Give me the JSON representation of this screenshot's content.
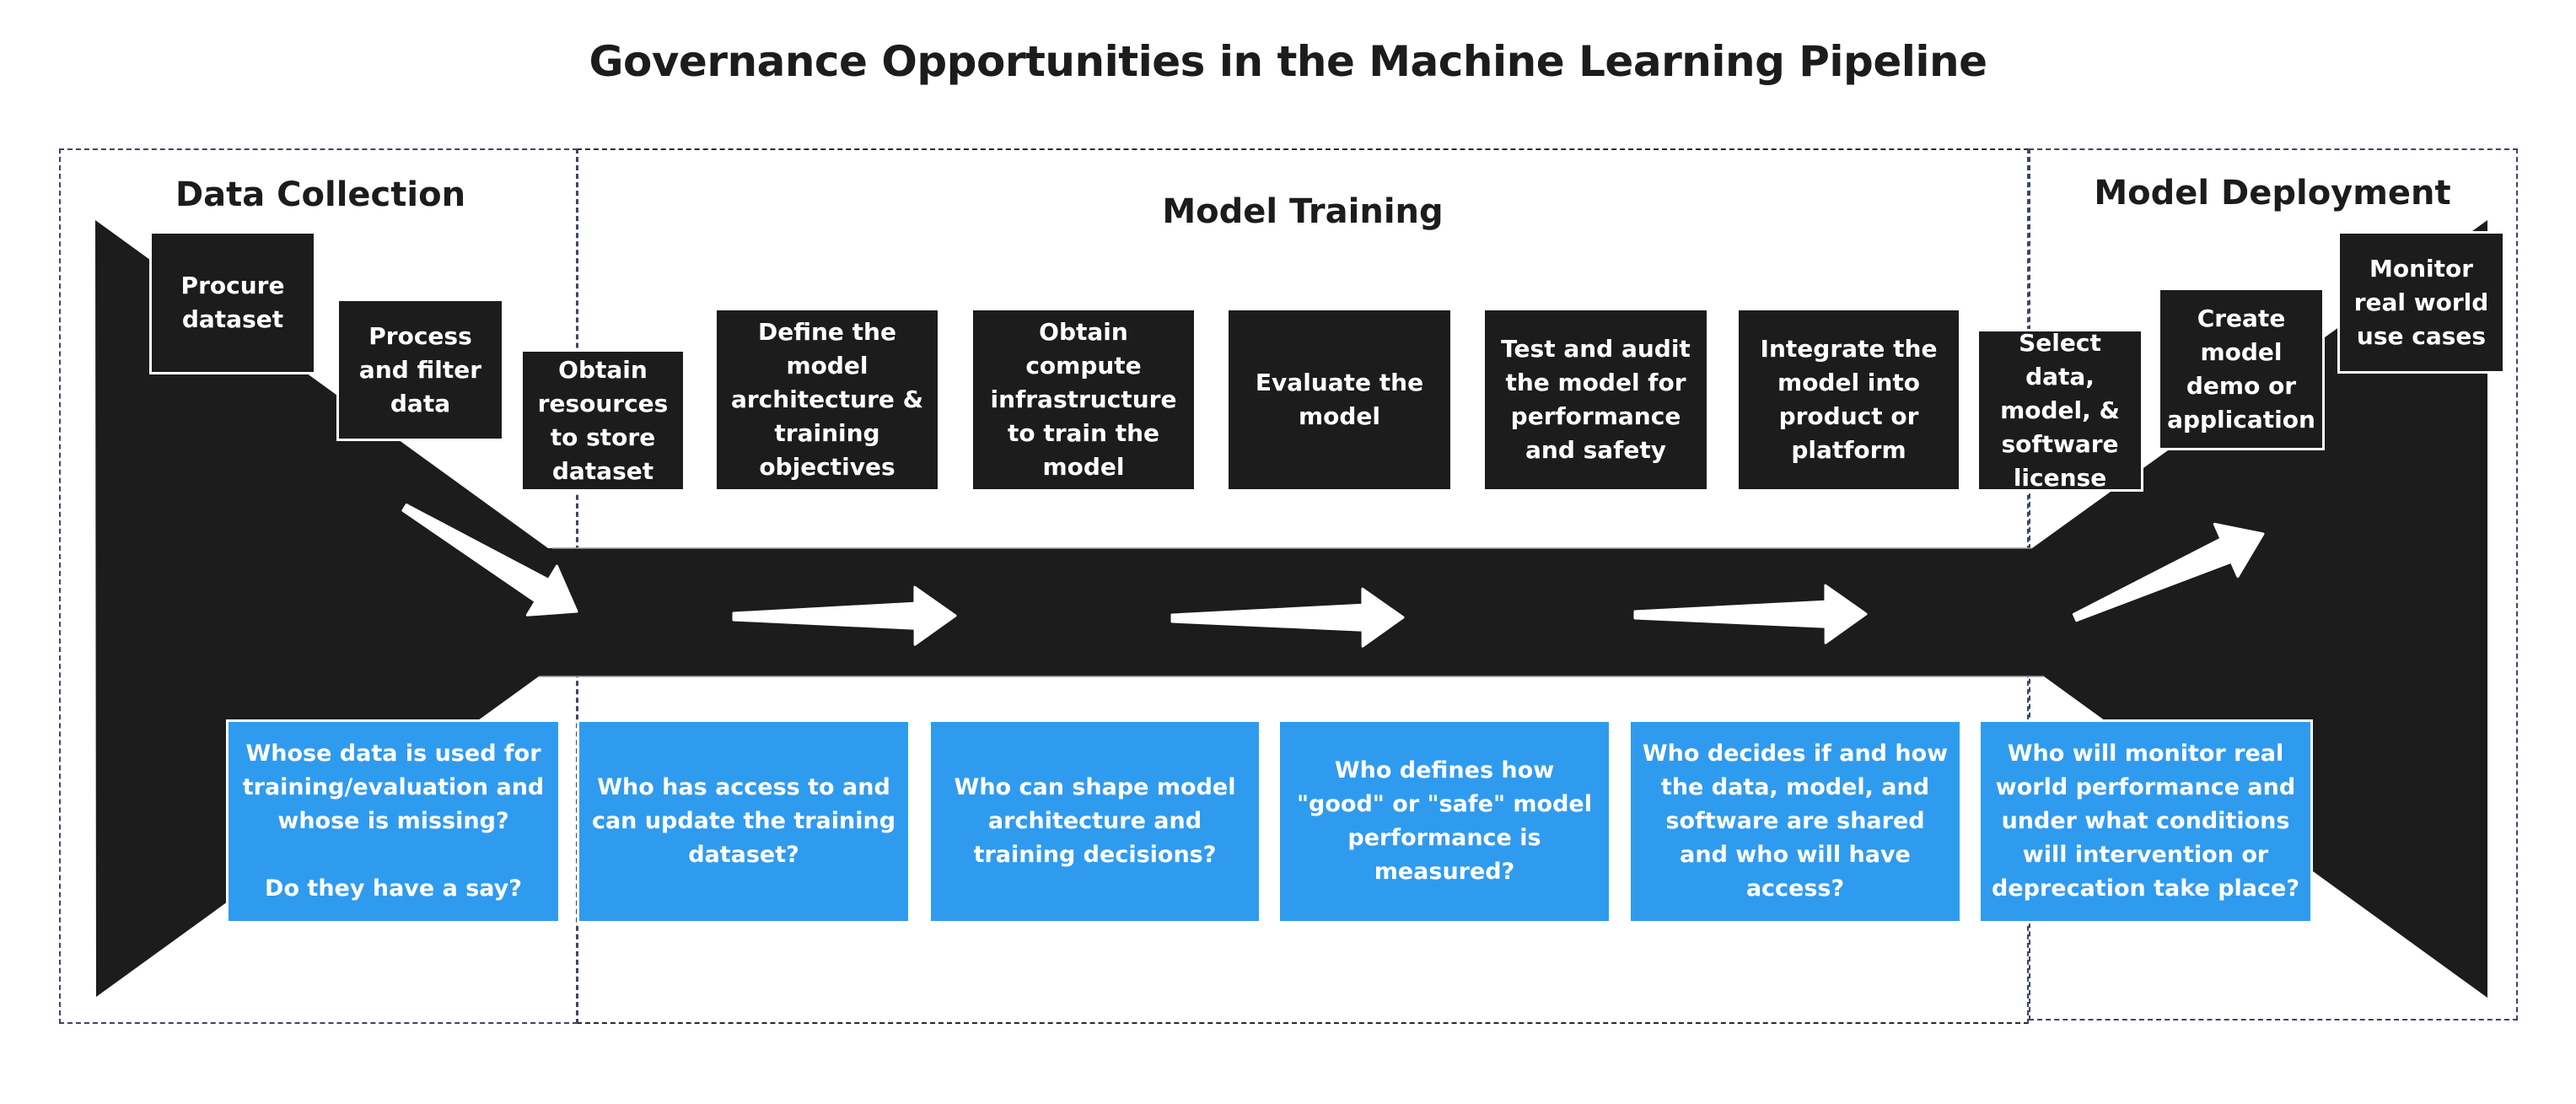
{
  "title": "Governance Opportunities in the Machine Learning Pipeline",
  "colors": {
    "step_fill": "#1c1c1c",
    "question_fill": "#2f9bef",
    "text_light": "#ffffff",
    "text_dark": "#1c1c1c",
    "section_border": "#3d4468"
  },
  "sections": [
    {
      "id": "data-collection",
      "title": "Data Collection"
    },
    {
      "id": "model-training",
      "title": "Model Training"
    },
    {
      "id": "model-deployment",
      "title": "Model Deployment"
    }
  ],
  "steps": [
    {
      "section": "data-collection",
      "label": "Procure dataset"
    },
    {
      "section": "data-collection",
      "label": "Process and filter data"
    },
    {
      "section": "model-training",
      "label": "Obtain resources to store dataset"
    },
    {
      "section": "model-training",
      "label": "Define the model architecture & training objectives"
    },
    {
      "section": "model-training",
      "label": "Obtain compute infrastructure to train the model"
    },
    {
      "section": "model-training",
      "label": "Evaluate the model"
    },
    {
      "section": "model-training",
      "label": "Test and audit the model for performance and safety"
    },
    {
      "section": "model-training",
      "label": "Integrate the model into product or platform"
    },
    {
      "section": "model-deployment",
      "label": "Select data, model, & software license"
    },
    {
      "section": "model-deployment",
      "label": "Create model demo or application"
    },
    {
      "section": "model-deployment",
      "label": "Monitor real world use cases"
    }
  ],
  "questions": [
    {
      "text": "Whose data is used for training/evaluation and whose is missing?\n\nDo they have a say?"
    },
    {
      "text": "Who has access to and can update the training dataset?"
    },
    {
      "text": "Who can shape model architecture and training decisions?"
    },
    {
      "text": "Who defines how \"good\" or \"safe\" model performance is measured?"
    },
    {
      "text": "Who decides if and how the data, model, and software are shared and who will have access?"
    },
    {
      "text": "Who will monitor real world performance and under what conditions will intervention or deprecation take place?"
    }
  ],
  "flow_arrows": [
    {
      "direction": "down-right",
      "meaning": "into pipeline"
    },
    {
      "direction": "right"
    },
    {
      "direction": "right"
    },
    {
      "direction": "right"
    },
    {
      "direction": "up-right",
      "meaning": "out to deployment"
    }
  ]
}
